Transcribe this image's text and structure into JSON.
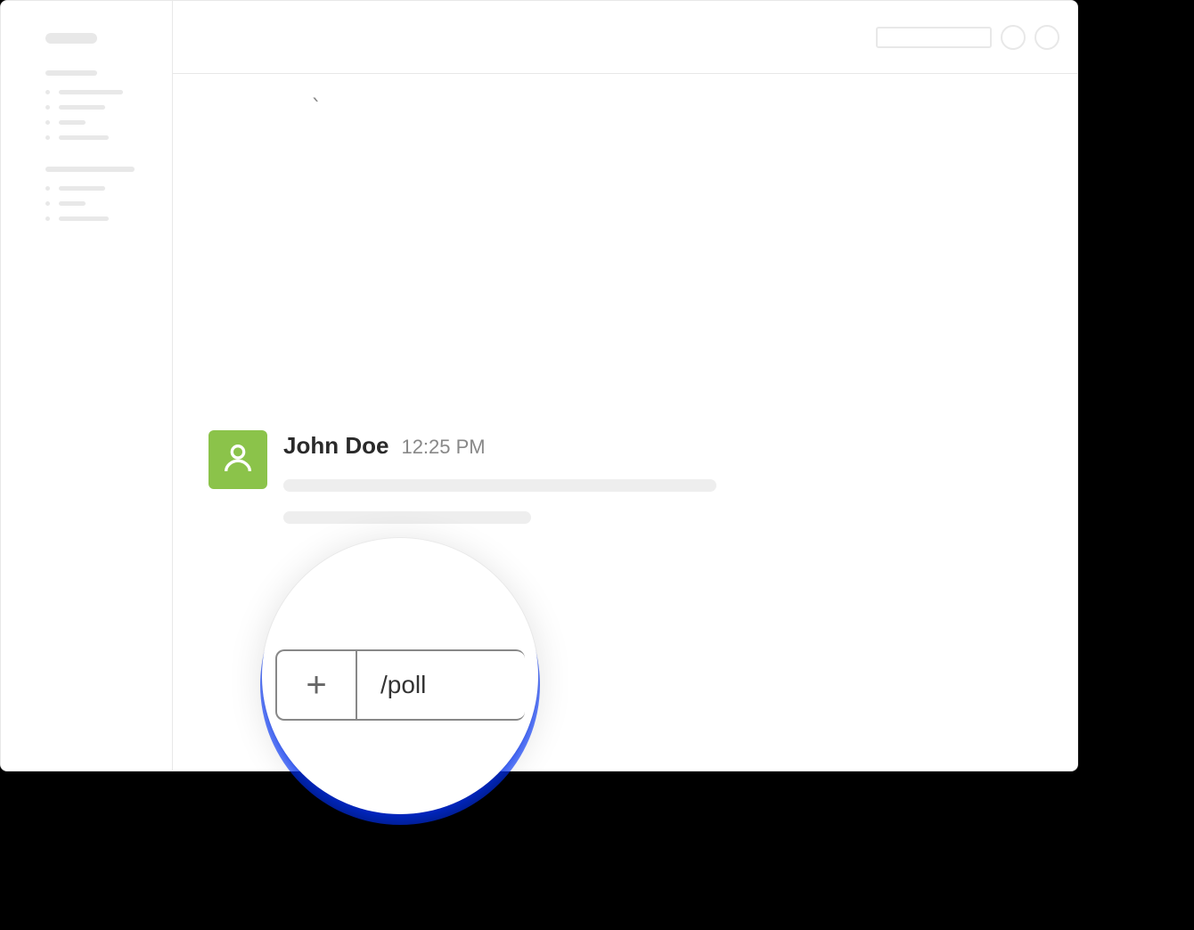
{
  "message": {
    "author": "John Doe",
    "time": "12:25 PM",
    "avatar_color": "#8bc34a"
  },
  "composer": {
    "command_text": "/poll",
    "plus_label": "+"
  },
  "sidebar": {
    "items_a": [
      72,
      52,
      30,
      56
    ],
    "items_b": [
      52,
      30,
      56
    ]
  },
  "stray": {
    "backtick": "`"
  }
}
